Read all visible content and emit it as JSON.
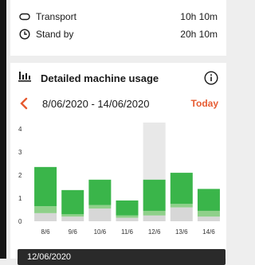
{
  "summary": {
    "rows": [
      {
        "icon": "transport-icon",
        "label": "Transport",
        "value": "10h 10m"
      },
      {
        "icon": "clock-icon",
        "label": "Stand by",
        "value": "20h 10m"
      }
    ]
  },
  "usage_card": {
    "title": "Detailed machine usage",
    "date_range": "8/06/2020 - 14/06/2020",
    "today_label": "Today"
  },
  "tooltip": {
    "text": "12/06/2020"
  },
  "colors": {
    "accent": "#e65b31",
    "green": "#3ab54a",
    "light_green": "#8fd08a",
    "grey": "#d7d7d7",
    "highlight": "#e8e8e8"
  },
  "chart_data": {
    "type": "bar",
    "categories": [
      "8/6",
      "9/6",
      "10/6",
      "11/6",
      "12/6",
      "13/6",
      "14/6"
    ],
    "ylim": [
      0,
      4
    ],
    "yticks": [
      0,
      1,
      2,
      3,
      4
    ],
    "selected_index": 4,
    "grid": false,
    "series": [
      {
        "values": [
          0.35,
          0.2,
          0.55,
          0.15,
          0.25,
          0.6,
          0.2
        ]
      },
      {
        "values": [
          0.3,
          0.1,
          0.15,
          0.1,
          0.2,
          0.15,
          0.25
        ]
      },
      {
        "values": [
          1.7,
          1.05,
          1.1,
          0.65,
          1.35,
          1.35,
          0.95
        ]
      }
    ]
  }
}
